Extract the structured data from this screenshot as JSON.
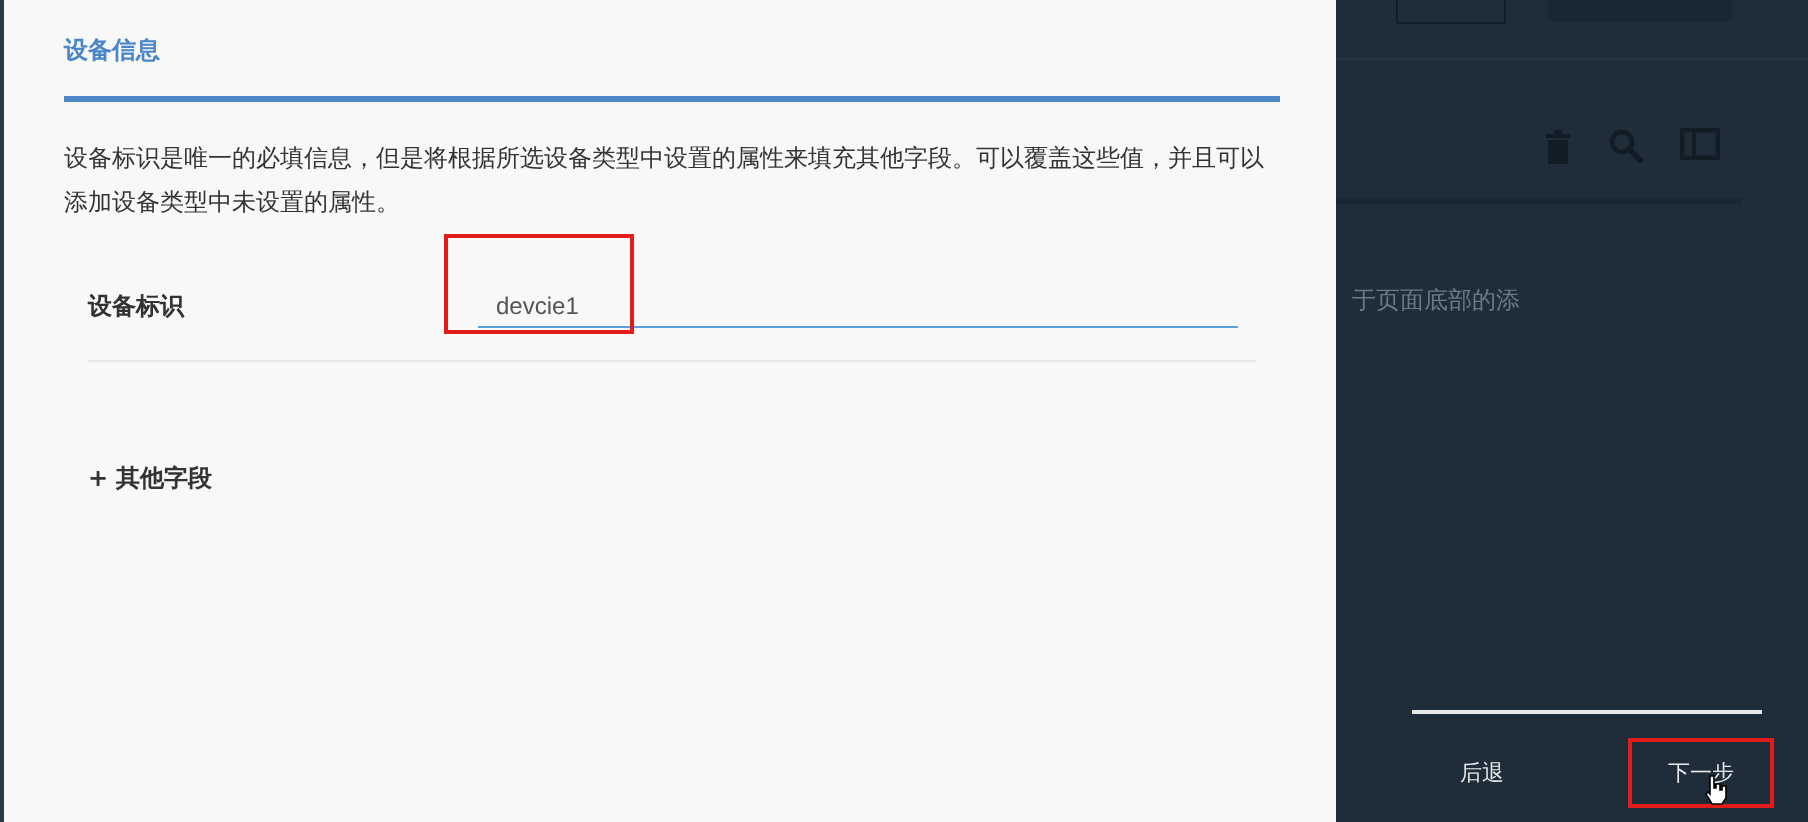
{
  "dialog": {
    "title": "设备信息",
    "description": "设备标识是唯一的必填信息，但是将根据所选设备类型中设置的属性来填充其他字段。可以覆盖这些值，并且可以添加设备类型中未设置的属性。",
    "fields": [
      {
        "label": "设备标识",
        "value": "devcie1",
        "highlighted": true
      }
    ],
    "add_link": "+ 其他字段"
  },
  "background": {
    "text": "于页面底部的添"
  },
  "footer": {
    "buttons": [
      {
        "label": "后退",
        "highlighted": false
      },
      {
        "label": "下一步",
        "highlighted": true
      }
    ]
  }
}
